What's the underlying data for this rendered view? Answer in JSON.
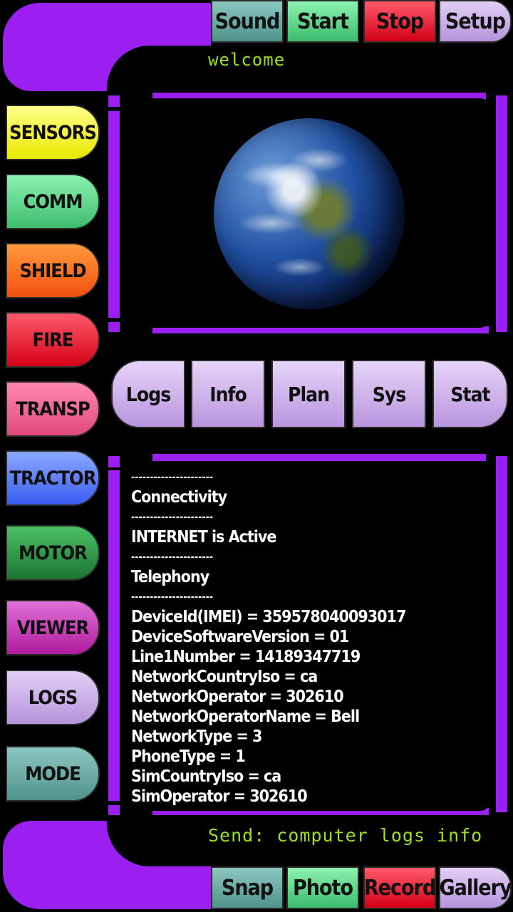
{
  "top_buttons": {
    "sound": "Sound",
    "start": "Start",
    "stop": "Stop",
    "setup": "Setup"
  },
  "bottom_buttons": {
    "snap": "Snap",
    "photo": "Photo",
    "record": "Record",
    "gallery": "Gallery"
  },
  "welcome": "welcome",
  "send_text": "Send: computer logs info",
  "side_buttons": [
    "SENSORS",
    "COMM",
    "SHIELD",
    "FIRE",
    "TRANSP",
    "TRACTOR",
    "MOTOR",
    "VIEWER",
    "LOGS",
    "MODE"
  ],
  "tabs": [
    "Logs",
    "Info",
    "Plan",
    "Sys",
    "Stat"
  ],
  "log_lines": [
    "----------------------",
    "Connectivity",
    "----------------------",
    "INTERNET is Active",
    "----------------------",
    "Telephony",
    "----------------------",
    "DeviceId(IMEI) = 359578040093017",
    "DeviceSoftwareVersion = 01",
    "Line1Number = 14189347719",
    "NetworkCountryIso = ca",
    "NetworkOperator = 302610",
    "NetworkOperatorName = Bell",
    "NetworkType = 3",
    "PhoneType = 1",
    "SimCountryIso = ca",
    "SimOperator = 302610"
  ],
  "colors": {
    "frame": "#9b1ff0",
    "text_accent": "#9be021"
  },
  "icons": {
    "viewer_image": "earth-globe"
  }
}
